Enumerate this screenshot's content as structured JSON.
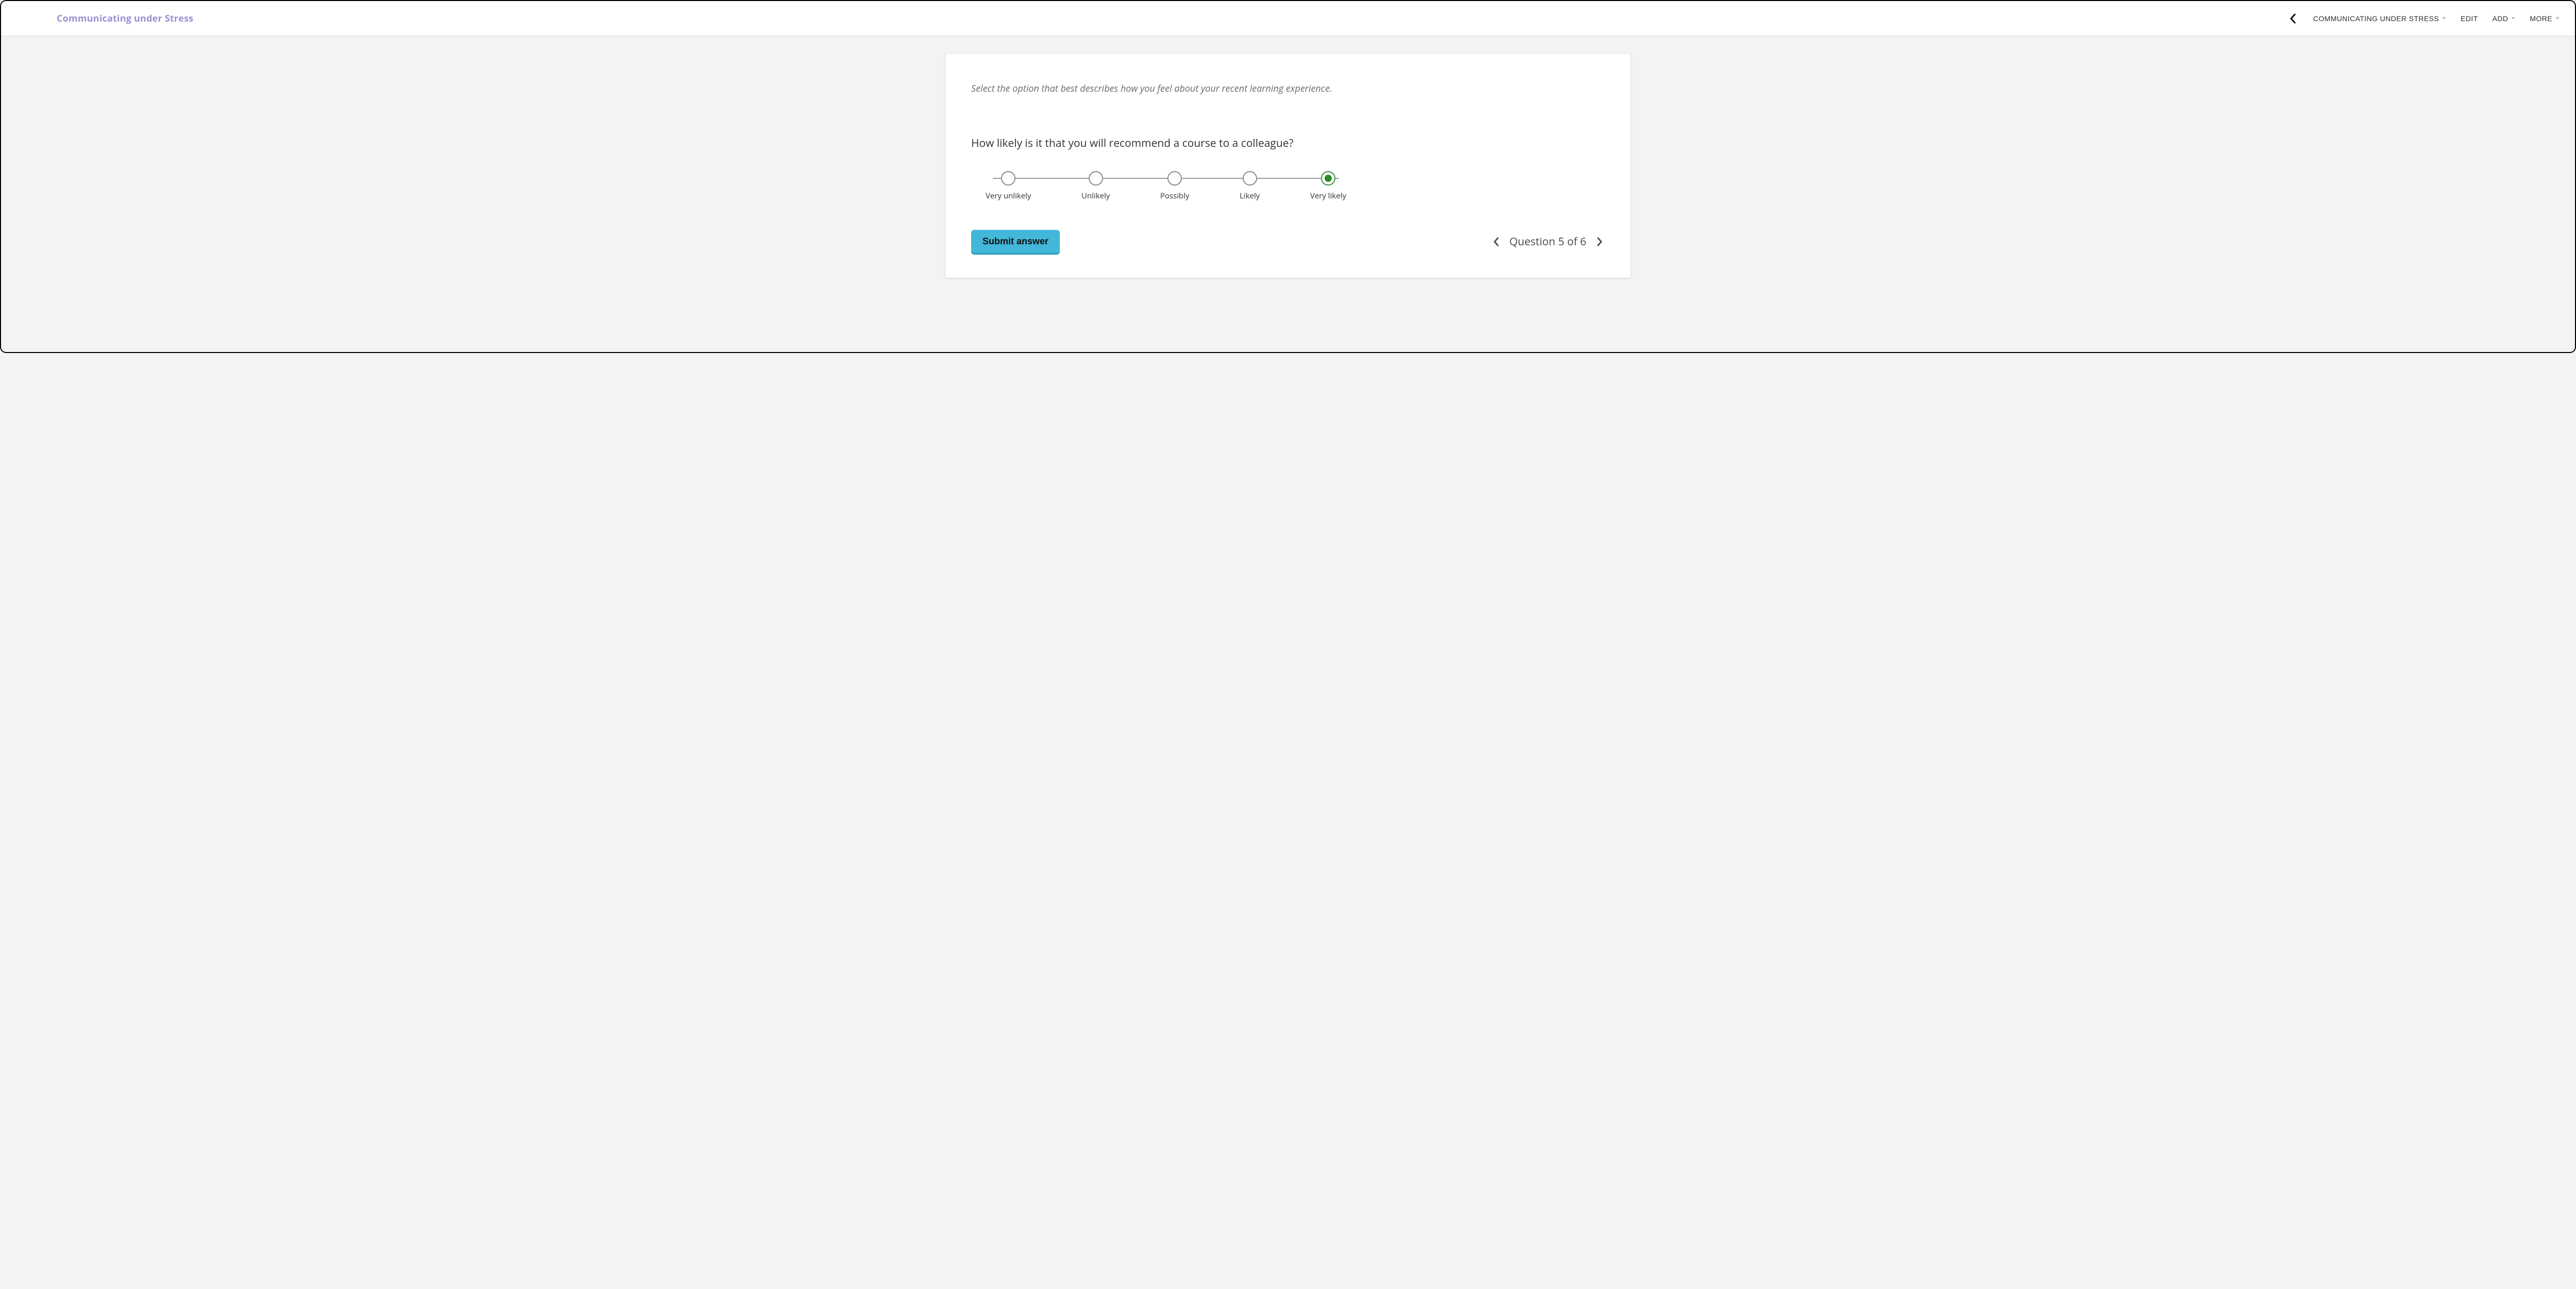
{
  "header": {
    "title": "Communicating under Stress",
    "nav": {
      "course_label": "COMMUNICATING UNDER STRESS",
      "edit_label": "EDIT",
      "add_label": "ADD",
      "more_label": "MORE"
    }
  },
  "card": {
    "instruction": "Select the option that best describes how you feel about your recent learning experience.",
    "question": "How likely is it that you will recommend a course to a colleague?",
    "likert": {
      "selected_index": 4,
      "options": [
        {
          "label": "Very unlikely"
        },
        {
          "label": "Unlikely"
        },
        {
          "label": "Possibly"
        },
        {
          "label": "Likely"
        },
        {
          "label": "Very likely"
        }
      ]
    },
    "submit_label": "Submit answer",
    "pager_text": "Question 5 of 6"
  }
}
